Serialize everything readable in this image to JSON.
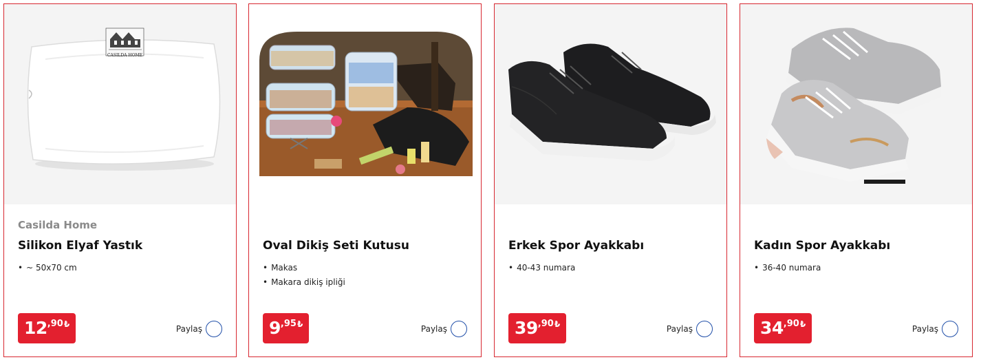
{
  "products": [
    {
      "brand": "Casilda Home",
      "title": "Silikon Elyaf Yastık",
      "features": [
        "~ 50x70 cm"
      ],
      "price": {
        "integer": "12",
        "decimal": ",90",
        "currency": "₺"
      },
      "share_label": "Paylaş",
      "image_logo_text": "CASILDA HOME"
    },
    {
      "brand": "",
      "title": "Oval Dikiş Seti Kutusu",
      "features": [
        "Makas",
        "Makara dikiş ipliği"
      ],
      "price": {
        "integer": "9",
        "decimal": ",95",
        "currency": "₺"
      },
      "share_label": "Paylaş"
    },
    {
      "brand": "",
      "title": "Erkek Spor Ayakkabı",
      "features": [
        "40-43 numara"
      ],
      "price": {
        "integer": "39",
        "decimal": ",90",
        "currency": "₺"
      },
      "share_label": "Paylaş"
    },
    {
      "brand": "",
      "title": "Kadın Spor Ayakkabı",
      "features": [
        "36-40 numara"
      ],
      "price": {
        "integer": "34",
        "decimal": ",90",
        "currency": "₺"
      },
      "share_label": "Paylaş"
    }
  ],
  "colors": {
    "border": "#d7262f",
    "price_bg": "#e3202f",
    "share_icon": "#1f4ea8",
    "brand_text": "#8a8a8a"
  },
  "icons": {
    "share": "share-circle-icon"
  }
}
